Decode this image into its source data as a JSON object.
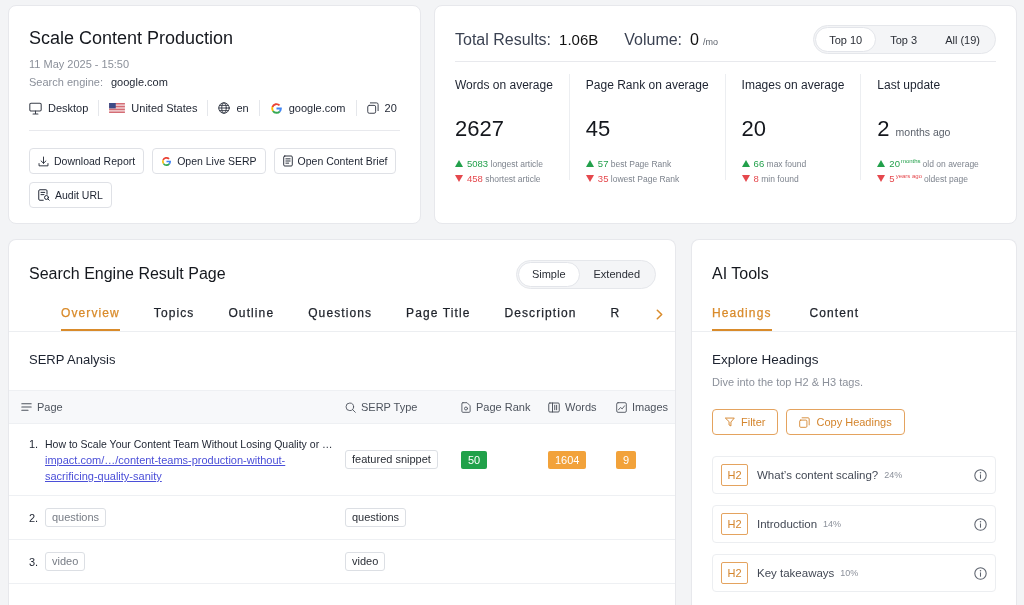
{
  "report": {
    "title": "Scale Content Production",
    "date": "11 May 2025 - 15:50",
    "search_engine_label": "Search engine:",
    "search_engine": "google.com",
    "meta": [
      {
        "kind": "device",
        "text": "Desktop"
      },
      {
        "kind": "country",
        "text": "United States"
      },
      {
        "kind": "language",
        "text": "en"
      },
      {
        "kind": "engine",
        "text": "google.com"
      },
      {
        "kind": "results",
        "text": "20"
      }
    ],
    "buttons": [
      {
        "kind": "download",
        "label": "Download Report"
      },
      {
        "kind": "live_serp",
        "label": "Open Live SERP"
      },
      {
        "kind": "brief",
        "label": "Open Content Brief"
      },
      {
        "kind": "audit",
        "label": "Audit URL"
      }
    ]
  },
  "summary": {
    "total_results_label": "Total Results:",
    "total_results": "1.06B",
    "volume_label": "Volume:",
    "volume": "0",
    "volume_unit": "/mo",
    "filters": [
      {
        "label": "Top 10",
        "selected": true
      },
      {
        "label": "Top 3",
        "selected": false
      },
      {
        "label": "All (19)",
        "selected": false
      }
    ],
    "stats": [
      {
        "label": "Words on average",
        "value": "2627",
        "max": {
          "value": "5083",
          "text": "longest article"
        },
        "min": {
          "value": "458",
          "text": "shortest article"
        }
      },
      {
        "label": "Page Rank on average",
        "value": "45",
        "max": {
          "value": "57",
          "text": "best Page Rank"
        },
        "min": {
          "value": "35",
          "text": "lowest Page Rank"
        }
      },
      {
        "label": "Images on average",
        "value": "20",
        "max": {
          "value": "66",
          "text": "max found"
        },
        "min": {
          "value": "8",
          "text": "min found"
        }
      },
      {
        "label": "Last update",
        "value": "2",
        "unit": "months ago",
        "max": {
          "value": "20",
          "unit": "months",
          "text": "old on average"
        },
        "min": {
          "value": "5",
          "unit": "years ago",
          "text": "oldest page"
        }
      }
    ]
  },
  "serp": {
    "title": "Search Engine Result Page",
    "modes": [
      {
        "label": "Simple",
        "selected": true
      },
      {
        "label": "Extended",
        "selected": false
      }
    ],
    "tabs": [
      {
        "label": "Overview",
        "selected": true
      },
      {
        "label": "Topics",
        "selected": false
      },
      {
        "label": "Outline",
        "selected": false
      },
      {
        "label": "Questions",
        "selected": false
      },
      {
        "label": "Page Title",
        "selected": false
      },
      {
        "label": "Description",
        "selected": false
      },
      {
        "label": "R",
        "selected": false
      }
    ],
    "section_title": "SERP Analysis",
    "table": {
      "columns": [
        {
          "kind": "page",
          "label": "Page"
        },
        {
          "kind": "type",
          "label": "SERP Type"
        },
        {
          "kind": "rank",
          "label": "Page Rank"
        },
        {
          "kind": "words",
          "label": "Words"
        },
        {
          "kind": "images",
          "label": "Images"
        }
      ],
      "rows": [
        {
          "kind": "result",
          "number": "1.",
          "title": "How to Scale Your Content Team Without Losing Quality or …",
          "url": "impact.com/…/content-teams-production-without-sacrificing-quality-sanity",
          "serp_type": "featured snippet",
          "metrics": [
            {
              "kind": "rank",
              "value": "50",
              "color": "#21a14a"
            },
            {
              "kind": "words",
              "value": "1604",
              "color": "#f2a23a"
            },
            {
              "kind": "images",
              "value": "9",
              "color": "#f2a23a"
            }
          ]
        },
        {
          "kind": "feature",
          "number": "2.",
          "tag": "questions",
          "serp_type": "questions"
        },
        {
          "kind": "feature",
          "number": "3.",
          "tag": "video",
          "serp_type": "video"
        }
      ]
    }
  },
  "ai_tools": {
    "title": "AI Tools",
    "tabs": [
      {
        "label": "Headings",
        "selected": true
      },
      {
        "label": "Content",
        "selected": false
      }
    ],
    "section_title": "Explore Headings",
    "description": "Dive into the top H2 & H3 tags.",
    "buttons": [
      {
        "kind": "filter",
        "label": "Filter"
      },
      {
        "kind": "copy",
        "label": "Copy Headings"
      }
    ],
    "headings": [
      {
        "level": "H2",
        "text": "What’s content scaling?",
        "share": "24%"
      },
      {
        "level": "H2",
        "text": "Introduction",
        "share": "14%"
      },
      {
        "level": "H2",
        "text": "Key takeaways",
        "share": "10%"
      }
    ]
  }
}
